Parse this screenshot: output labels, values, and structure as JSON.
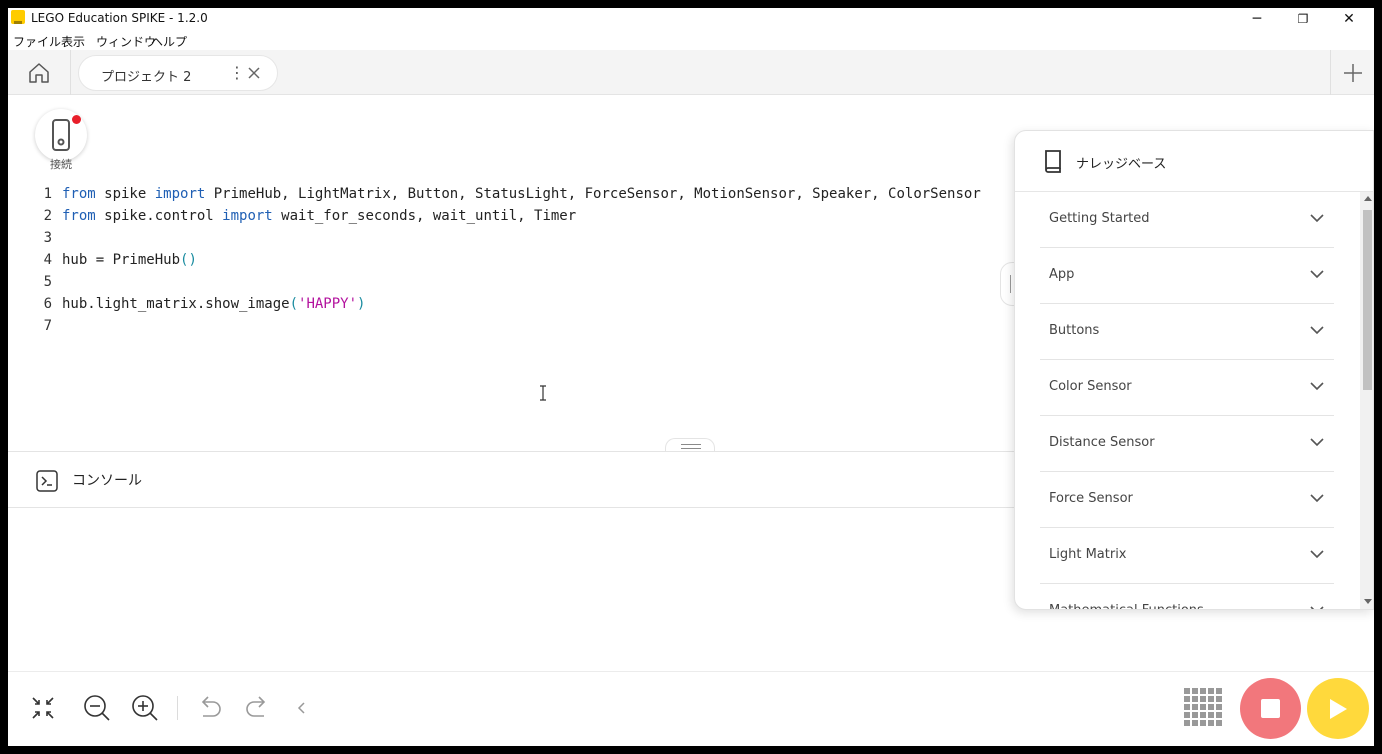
{
  "window": {
    "title": "LEGO Education SPIKE - 1.2.0",
    "controls": {
      "minimize": "─",
      "restore": "❐",
      "close": "✕"
    }
  },
  "menubar": [
    "ファイル",
    "表示",
    "ウィンドウ",
    "ヘルプ"
  ],
  "tabs": {
    "project_label": "プロジェクト 2",
    "menu_glyph": "⋮"
  },
  "connect": {
    "label": "接続",
    "status_color": "#e81e2a"
  },
  "code": {
    "lines": [
      {
        "n": "1",
        "parts": [
          [
            "kw",
            "from"
          ],
          [
            "t",
            " spike "
          ],
          [
            "kw",
            "import"
          ],
          [
            "t",
            " PrimeHub, LightMatrix, Button, StatusLight, ForceSensor, MotionSensor, Speaker, ColorSensor"
          ]
        ]
      },
      {
        "n": "2",
        "parts": [
          [
            "kw",
            "from"
          ],
          [
            "t",
            " spike.control "
          ],
          [
            "kw",
            "import"
          ],
          [
            "t",
            " wait_for_seconds, wait_until, Timer"
          ]
        ]
      },
      {
        "n": "3",
        "parts": []
      },
      {
        "n": "4",
        "parts": [
          [
            "t",
            "hub = PrimeHub"
          ],
          [
            "paren",
            "()"
          ]
        ]
      },
      {
        "n": "5",
        "parts": []
      },
      {
        "n": "6",
        "parts": [
          [
            "t",
            "hub.light_matrix.show_image"
          ],
          [
            "paren",
            "("
          ],
          [
            "str",
            "'HAPPY'"
          ],
          [
            "paren",
            ")"
          ]
        ]
      },
      {
        "n": "7",
        "parts": []
      }
    ]
  },
  "console": {
    "title": "コンソール"
  },
  "knowledge_base": {
    "title": "ナレッジベース",
    "items": [
      "Getting Started",
      "App",
      "Buttons",
      "Color Sensor",
      "Distance Sensor",
      "Force Sensor",
      "Light Matrix",
      "Mathematical Functions"
    ]
  },
  "footer": {
    "buttons": [
      "collapse-icon",
      "zoom-out-icon",
      "zoom-in-icon",
      "undo-icon",
      "redo-icon",
      "chevron-left-icon"
    ],
    "stop_color": "#f2777c",
    "run_color": "#ffd93c"
  }
}
